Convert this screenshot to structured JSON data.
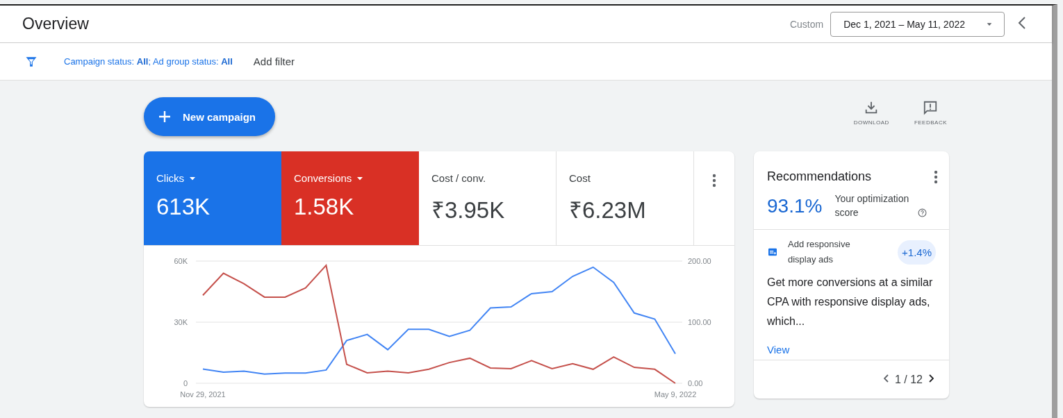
{
  "header": {
    "title": "Overview",
    "range_label": "Custom",
    "date_range": "Dec 1, 2021 – May 11, 2022"
  },
  "filter_bar": {
    "filter_text": "Campaign status: **All**; Ad group status: **All**",
    "add_filter": "Add filter"
  },
  "new_campaign": "New campaign",
  "actions": [
    {
      "label": "DOWNLOAD",
      "kind": "download"
    },
    {
      "label": "FEEDBACK",
      "kind": "feedback"
    }
  ],
  "metrics": [
    {
      "label": "Clicks",
      "value": "613K",
      "selected": true,
      "color": "#1a73e8"
    },
    {
      "label": "Conversions",
      "value": "1.58K",
      "selected": true,
      "color": "#d93025"
    },
    {
      "label": "Cost / conv.",
      "value": "₹3.95K",
      "selected": false
    },
    {
      "label": "Cost",
      "value": "₹6.23M",
      "selected": false
    }
  ],
  "chart_data": {
    "type": "line",
    "categories": [
      "Nov 29, 2021",
      null,
      null,
      null,
      null,
      null,
      null,
      null,
      null,
      null,
      null,
      null,
      null,
      null,
      null,
      null,
      null,
      null,
      null,
      null,
      null,
      null,
      null,
      "May 9, 2022"
    ],
    "ylim": [
      0,
      60000
    ],
    "yticks": [
      {
        "value": 0,
        "label": "0"
      },
      {
        "value": 30000,
        "label": "30K"
      },
      {
        "value": 60000,
        "label": "60K"
      }
    ],
    "y2lim": [
      0,
      200
    ],
    "y2ticks": [
      {
        "value": 0,
        "label": "0.00"
      },
      {
        "value": 100,
        "label": "100.00"
      },
      {
        "value": 200,
        "label": "200.00"
      }
    ],
    "series": [
      {
        "color": "#4285f4",
        "values": [
          7000,
          5500,
          6000,
          4500,
          5000,
          5000,
          6500,
          21000,
          24000,
          16500,
          26500,
          26500,
          23000,
          26000,
          37000,
          37500,
          44000,
          45000,
          52500,
          57000,
          49500,
          34500,
          31500,
          14500
        ]
      },
      {
        "color": "#c5504b",
        "axis": "y2",
        "values": [
          144,
          180,
          163,
          141,
          141,
          156,
          193,
          31,
          17,
          20,
          17,
          23,
          34,
          41,
          25,
          24,
          37,
          24,
          32,
          23,
          43,
          26,
          23,
          0
        ]
      }
    ]
  },
  "recommendations": {
    "title": "Recommendations",
    "score": "93.1%",
    "score_label": "Your optimization score",
    "item_title": "Add responsive display ads",
    "uplift": "+1.4%",
    "description": "Get more conversions at a similar CPA with responsive display ads, which...",
    "link": "View",
    "pager": "1 / 12"
  }
}
